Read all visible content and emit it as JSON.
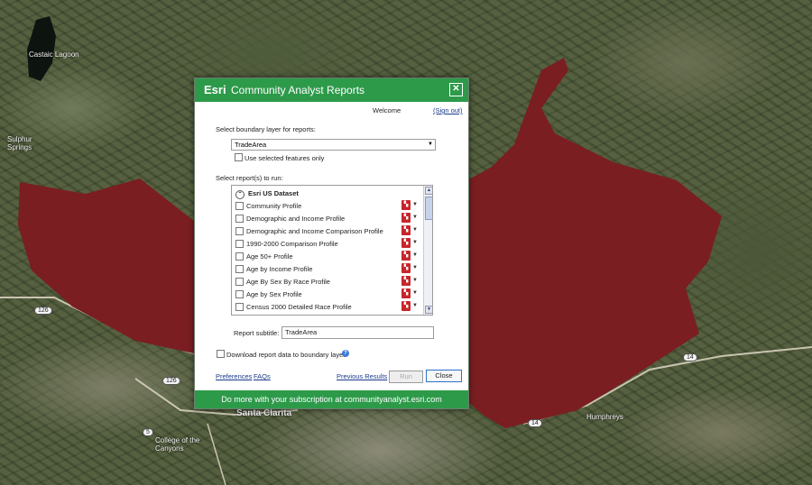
{
  "map": {
    "labels": {
      "castaic_lagoon": "Castaic Lagoon",
      "sulphur_springs": "Sulphur Springs",
      "santa_clarita": "Santa Clarita",
      "college": "College of the Canyons",
      "humphreys": "Humphreys"
    },
    "highways": {
      "h126a": "126",
      "h126b": "126",
      "h126c": "126",
      "h14a": "14",
      "h14b": "14",
      "h5": "5"
    },
    "boundary_color": "#7a1e22"
  },
  "dialog": {
    "brand": "Esri",
    "title": "Community Analyst Reports",
    "welcome": "Welcome",
    "sign_out": "(Sign out)",
    "boundary_label": "Select boundary layer for reports:",
    "boundary_value": "TradeArea",
    "use_selected": "Use selected features only",
    "reports_label": "Select report(s) to run:",
    "dataset": "Esri US Dataset",
    "reports": [
      "Community Profile",
      "Demographic and Income Profile",
      "Demographic and Income Comparison Profile",
      "1990-2000 Comparison Profile",
      "Age 50+ Profile",
      "Age by Income Profile",
      "Age By Sex By Race Profile",
      "Age by Sex Profile",
      "Census 2000 Detailed Race Profile"
    ],
    "subtitle_label": "Report subtitle:",
    "subtitle_value": "TradeArea",
    "download_label": "Download report data to boundary layer",
    "preferences": "Preferences",
    "faqs": "FAQs",
    "previous_results": "Previous Results",
    "run": "Run",
    "close": "Close",
    "footer": "Do more with your subscription at communityanalyst.esri.com"
  },
  "colors": {
    "accent": "#2d9a4a",
    "pdf": "#c8252b"
  }
}
